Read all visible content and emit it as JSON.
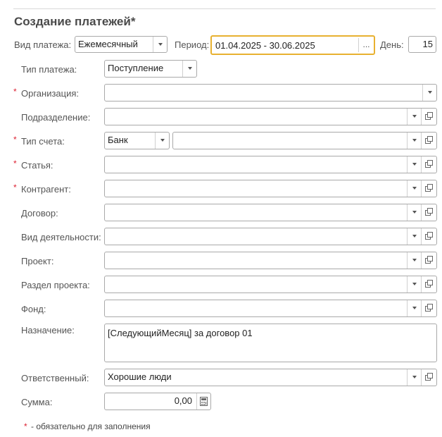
{
  "form": {
    "title": "Создание платежей*",
    "required_note": "- обязательно для заполнения",
    "required_mark": "*"
  },
  "top_row": {
    "payment_kind_label": "Вид платежа:",
    "payment_kind_value": "Ежемесячный",
    "period_label": "Период:",
    "period_value": "01.04.2025 - 30.06.2025",
    "period_button": "...",
    "day_label": "День:",
    "day_value": "15"
  },
  "fields": {
    "payment_type": {
      "label": "Тип платежа:",
      "value": "Поступление"
    },
    "organization": {
      "label": "Организация:",
      "value": ""
    },
    "department": {
      "label": "Подразделение:",
      "value": ""
    },
    "account_type": {
      "label": "Тип счета:",
      "value": "Банк",
      "account_value": ""
    },
    "article": {
      "label": "Статья:",
      "value": ""
    },
    "counterparty": {
      "label": "Контрагент:",
      "value": ""
    },
    "contract": {
      "label": "Договор:",
      "value": ""
    },
    "activity": {
      "label": "Вид деятельности:",
      "value": ""
    },
    "project": {
      "label": "Проект:",
      "value": ""
    },
    "project_section": {
      "label": "Раздел проекта:",
      "value": ""
    },
    "fund": {
      "label": "Фонд:",
      "value": ""
    },
    "purpose": {
      "label": "Назначение:",
      "value": "[СледующийМесяц] за договор 01"
    },
    "responsible": {
      "label": "Ответственный:",
      "value": "Хорошие люди"
    },
    "amount": {
      "label": "Сумма:",
      "value": "0,00"
    }
  }
}
